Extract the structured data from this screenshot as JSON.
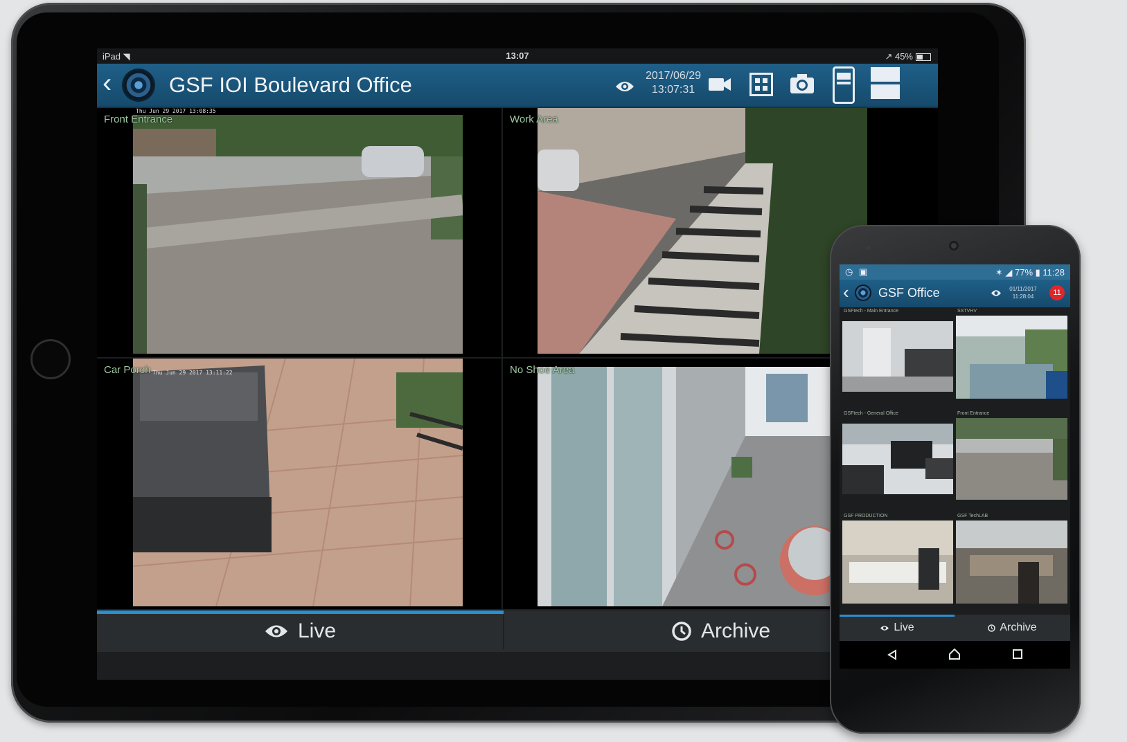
{
  "tablet": {
    "status": {
      "device": "iPad",
      "time": "13:07",
      "battery": "45%"
    },
    "header": {
      "title": "GSF IOI Boulevard Office",
      "date": "2017/06/29",
      "time": "13:07:31"
    },
    "cameras": [
      {
        "label": "Front Entrance",
        "timestamp": "Thu Jun 29 2017 13:08:35"
      },
      {
        "label": "Work Area",
        "timestamp": ""
      },
      {
        "label": "Car Porch",
        "timestamp": "Thu Jun 29 2017 13:11:22"
      },
      {
        "label": "No Shoe Area",
        "timestamp": ""
      }
    ],
    "tabs": {
      "live": "Live",
      "archive": "Archive"
    }
  },
  "phone": {
    "status": {
      "battery": "77%",
      "time": "11:28"
    },
    "header": {
      "title": "GSF Office",
      "date": "01/11/2017",
      "time": "11:28:04",
      "badge": "11"
    },
    "cameras": [
      {
        "label": "GSFtech - Main Entrance"
      },
      {
        "label": "SSTVHV"
      },
      {
        "label": "GSFtech - General Office"
      },
      {
        "label": "Front Entrance"
      },
      {
        "label": "GSF PRODUCTION"
      },
      {
        "label": "GSF TechLAB"
      }
    ],
    "tabs": {
      "live": "Live",
      "archive": "Archive"
    }
  },
  "colors": {
    "header_blue": "#1d5a82",
    "accent_blue": "#2b8fd0",
    "label_green": "#9fc7a3",
    "badge_red": "#e0262b"
  }
}
